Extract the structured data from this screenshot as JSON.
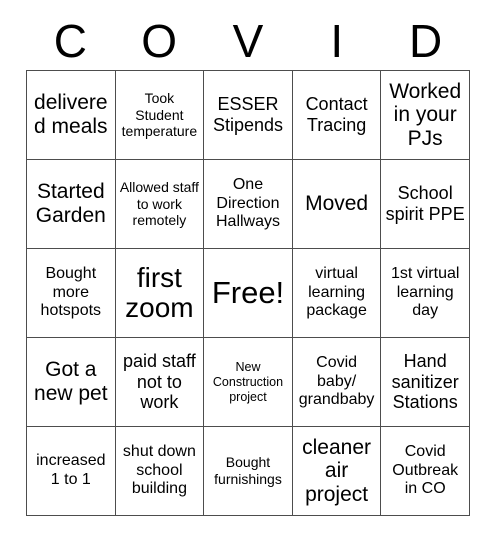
{
  "card": {
    "title_letters": [
      "C",
      "O",
      "V",
      "I",
      "D"
    ],
    "columns": 5,
    "rows": 5,
    "border_color": "#4d4d4d",
    "background_color": "#ffffff",
    "text_color": "#000000",
    "free_space_index": 12,
    "cells": [
      {
        "text": "delivered meals",
        "size": "lg"
      },
      {
        "text": "Took Student temperature",
        "size": "xs"
      },
      {
        "text": "ESSER Stipends",
        "size": "md"
      },
      {
        "text": "Contact Tracing",
        "size": "md"
      },
      {
        "text": "Worked in your PJs",
        "size": "lg"
      },
      {
        "text": "Started Garden",
        "size": "lg"
      },
      {
        "text": "Allowed staff to work remotely",
        "size": "xs"
      },
      {
        "text": "One Direction Hallways",
        "size": "sm"
      },
      {
        "text": "Moved",
        "size": "lg"
      },
      {
        "text": "School spirit PPE",
        "size": "md"
      },
      {
        "text": "Bought more hotspots",
        "size": "sm"
      },
      {
        "text": "first zoom",
        "size": "xl"
      },
      {
        "text": "Free!",
        "size": "xxl"
      },
      {
        "text": "virtual learning package",
        "size": "sm"
      },
      {
        "text": "1st virtual learning day",
        "size": "sm"
      },
      {
        "text": "Got a new pet",
        "size": "lg"
      },
      {
        "text": "paid staff not to work",
        "size": "md"
      },
      {
        "text": "New Construction project",
        "size": "xxs"
      },
      {
        "text": "Covid baby/ grandbaby",
        "size": "sm"
      },
      {
        "text": "Hand sanitizer Stations",
        "size": "md"
      },
      {
        "text": "increased 1 to 1",
        "size": "sm"
      },
      {
        "text": "shut down school building",
        "size": "sm"
      },
      {
        "text": "Bought furnishings",
        "size": "xs"
      },
      {
        "text": "cleaner air project",
        "size": "lg"
      },
      {
        "text": "Covid Outbreak in CO",
        "size": "sm"
      }
    ]
  }
}
